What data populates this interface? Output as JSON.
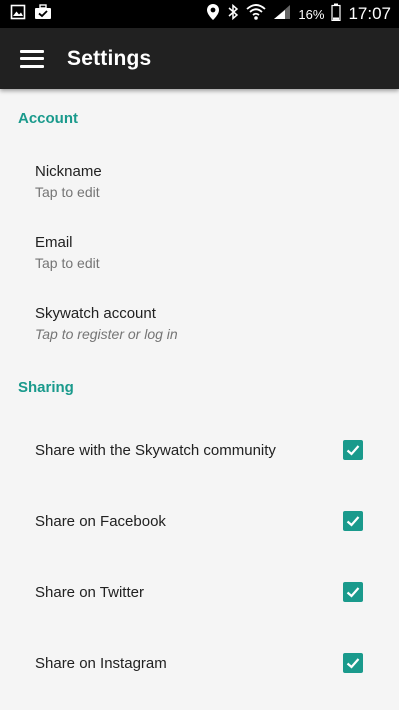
{
  "status_bar": {
    "battery": "16%",
    "time": "17:07",
    "icons": [
      "image-icon",
      "briefcase-check-icon",
      "location-pin-icon",
      "bluetooth-icon",
      "wifi-icon",
      "cell-signal-icon",
      "battery-icon"
    ]
  },
  "app_bar": {
    "title": "Settings",
    "menu_icon": "hamburger-menu-icon"
  },
  "sections": {
    "account": {
      "header": "Account",
      "nickname": {
        "title": "Nickname",
        "summary": "Tap to edit"
      },
      "email": {
        "title": "Email",
        "summary": "Tap to edit"
      },
      "skywatch": {
        "title": "Skywatch account",
        "summary": "Tap to register or log in"
      }
    },
    "sharing": {
      "header": "Sharing",
      "community": {
        "title": "Share with the Skywatch community",
        "checked": true
      },
      "facebook": {
        "title": "Share on Facebook",
        "checked": true
      },
      "twitter": {
        "title": "Share on Twitter",
        "checked": true
      },
      "instagram": {
        "title": "Share on Instagram",
        "checked": true
      }
    }
  },
  "colors": {
    "accent": "#1a9a8c",
    "app_bar": "#212121",
    "background": "#f5f5f5",
    "status_bar": "#000000"
  }
}
